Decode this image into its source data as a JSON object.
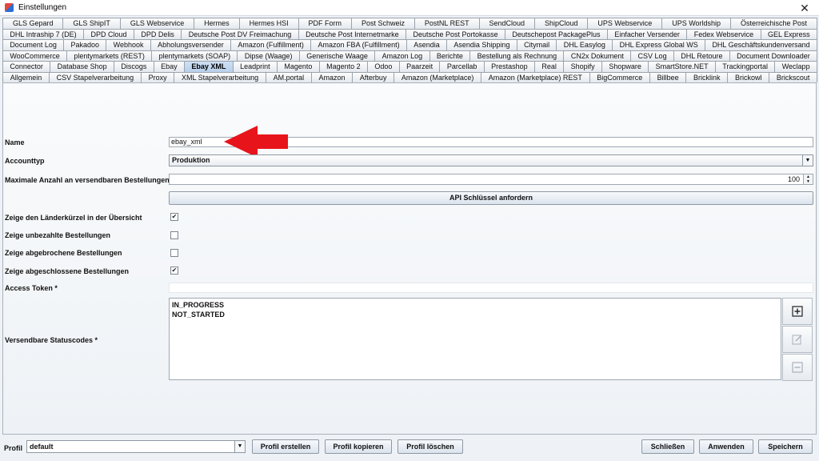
{
  "window": {
    "title": "Einstellungen"
  },
  "icons": {
    "close": "close-icon",
    "add": "add-icon",
    "edit": "edit-icon",
    "remove": "remove-icon",
    "dropdown": "chevron-down-icon"
  },
  "colors": {
    "arrow": "#e8141b",
    "selected_tab": "#b8cfea"
  },
  "tab_rows": [
    [
      "GLS Gepard",
      "GLS ShipIT",
      "GLS Webservice",
      "Hermes",
      "Hermes HSI",
      "PDF Form",
      "Post Schweiz",
      "PostNL REST",
      "SendCloud",
      "ShipCloud",
      "UPS Webservice",
      "UPS Worldship",
      "Österreichische Post"
    ],
    [
      "DHL Intraship 7 (DE)",
      "DPD Cloud",
      "DPD Delis",
      "Deutsche Post DV Freimachung",
      "Deutsche Post Internetmarke",
      "Deutsche Post Portokasse",
      "Deutschepost PackagePlus",
      "Einfacher Versender",
      "Fedex Webservice",
      "GEL Express"
    ],
    [
      "Document Log",
      "Pakadoo",
      "Webhook",
      "Abholungsversender",
      "Amazon (Fulfillment)",
      "Amazon FBA (Fulfillment)",
      "Asendia",
      "Asendia Shipping",
      "Citymail",
      "DHL Easylog",
      "DHL Express Global WS",
      "DHL Geschäftskundenversand"
    ],
    [
      "WooCommerce",
      "plentymarkets (REST)",
      "plentymarkets (SOAP)",
      "Dipse (Waage)",
      "Generische Waage",
      "Amazon Log",
      "Berichte",
      "Bestellung als Rechnung",
      "CN2x Dokument",
      "CSV Log",
      "DHL Retoure",
      "Document Downloader"
    ],
    [
      "Connector",
      "Database Shop",
      "Discogs",
      "Ebay",
      "Ebay XML",
      "Leadprint",
      "Magento",
      "Magento 2",
      "Odoo",
      "Paarzeit",
      "Parcellab",
      "Prestashop",
      "Real",
      "Shopify",
      "Shopware",
      "SmartStore.NET",
      "Trackingportal",
      "Weclapp"
    ],
    [
      "Allgemein",
      "CSV Stapelverarbeitung",
      "Proxy",
      "XML Stapelverarbeitung",
      "AM.portal",
      "Amazon",
      "Afterbuy",
      "Amazon (Marketplace)",
      "Amazon (Marketplace) REST",
      "BigCommerce",
      "Billbee",
      "Bricklink",
      "Brickowl",
      "Brickscout"
    ]
  ],
  "selected_tab": "Ebay XML",
  "form": {
    "name_label": "Name",
    "name_value": "ebay_xml",
    "accounttyp_label": "Accounttyp",
    "accounttyp_value": "Produktion",
    "max_label": "Maximale Anzahl an versendbaren Bestellungen",
    "max_value": "100",
    "api_button": "API Schlüssel anfordern",
    "checkboxes": [
      {
        "label": "Zeige den Länderkürzel in der Übersicht",
        "checked": true
      },
      {
        "label": "Zeige unbezahlte Bestellungen",
        "checked": false
      },
      {
        "label": "Zeige abgebrochene Bestellungen",
        "checked": false
      },
      {
        "label": "Zeige abgeschlossene Bestellungen",
        "checked": true
      }
    ],
    "access_token_label": "Access Token *",
    "access_token_value": "",
    "status_label": "Versendbare Statuscodes *",
    "status_codes": [
      "IN_PROGRESS",
      "NOT_STARTED"
    ]
  },
  "footer": {
    "profile_label": "Profil",
    "profile_value": "default",
    "create_button": "Profil erstellen",
    "copy_button": "Profil kopieren",
    "delete_button": "Profil löschen",
    "close_button": "Schließen",
    "apply_button": "Anwenden",
    "save_button": "Speichern"
  }
}
